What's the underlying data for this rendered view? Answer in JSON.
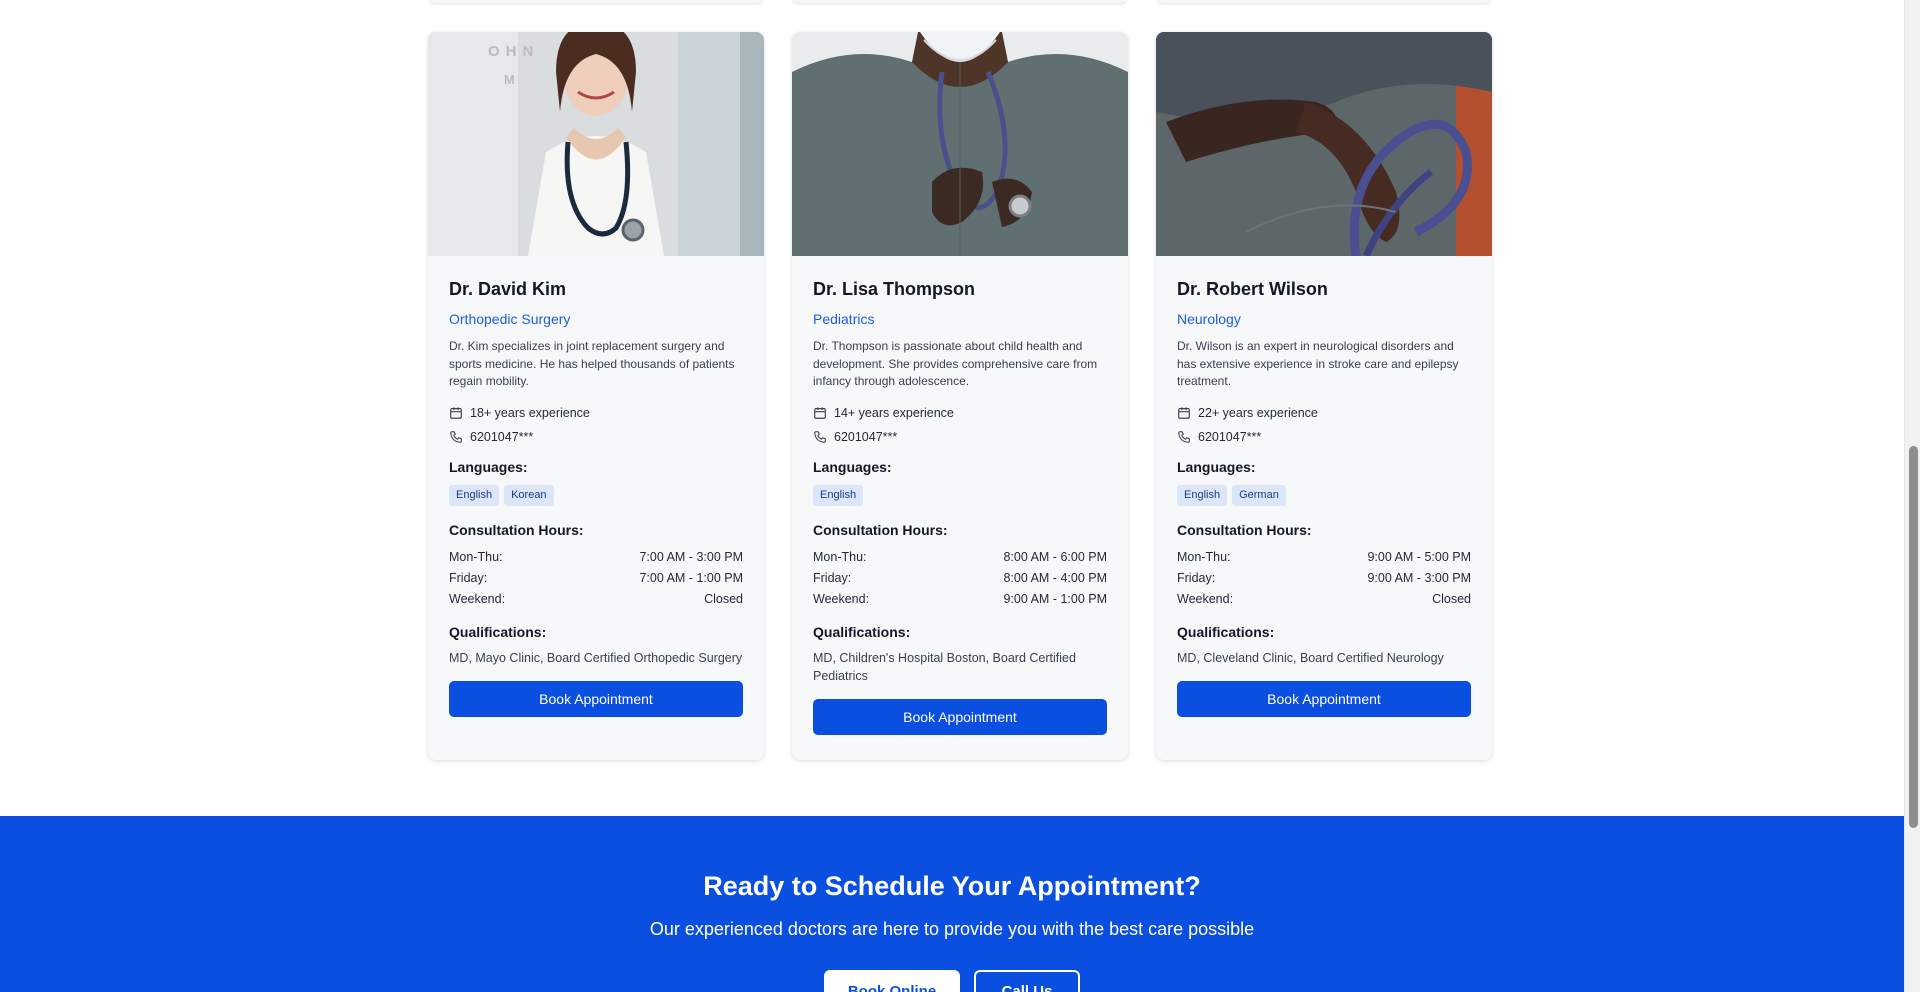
{
  "doctors": [
    {
      "name": "Dr. David Kim",
      "specialty": "Orthopedic Surgery",
      "bio": "Dr. Kim specializes in joint replacement surgery and sports medicine. He has helped thousands of patients regain mobility.",
      "experience": "18+ years experience",
      "phone": "6201047***",
      "languages_label": "Languages:",
      "languages": [
        "English",
        "Korean"
      ],
      "hours_label": "Consultation Hours:",
      "hours": [
        {
          "day": "Mon-Thu:",
          "time": "7:00 AM - 3:00 PM"
        },
        {
          "day": "Friday:",
          "time": "7:00 AM - 1:00 PM"
        },
        {
          "day": "Weekend:",
          "time": "Closed"
        }
      ],
      "qualifications_label": "Qualifications:",
      "qualifications": "MD, Mayo Clinic, Board Certified Orthopedic Surgery",
      "button": "Book Appointment"
    },
    {
      "name": "Dr. Lisa Thompson",
      "specialty": "Pediatrics",
      "bio": "Dr. Thompson is passionate about child health and development. She provides comprehensive care from infancy through adolescence.",
      "experience": "14+ years experience",
      "phone": "6201047***",
      "languages_label": "Languages:",
      "languages": [
        "English"
      ],
      "hours_label": "Consultation Hours:",
      "hours": [
        {
          "day": "Mon-Thu:",
          "time": "8:00 AM - 6:00 PM"
        },
        {
          "day": "Friday:",
          "time": "8:00 AM - 4:00 PM"
        },
        {
          "day": "Weekend:",
          "time": "9:00 AM - 1:00 PM"
        }
      ],
      "qualifications_label": "Qualifications:",
      "qualifications": "MD, Children's Hospital Boston, Board Certified Pediatrics",
      "button": "Book Appointment"
    },
    {
      "name": "Dr. Robert Wilson",
      "specialty": "Neurology",
      "bio": "Dr. Wilson is an expert in neurological disorders and has extensive experience in stroke care and epilepsy treatment.",
      "experience": "22+ years experience",
      "phone": "6201047***",
      "languages_label": "Languages:",
      "languages": [
        "English",
        "German"
      ],
      "hours_label": "Consultation Hours:",
      "hours": [
        {
          "day": "Mon-Thu:",
          "time": "9:00 AM - 5:00 PM"
        },
        {
          "day": "Friday:",
          "time": "9:00 AM - 3:00 PM"
        },
        {
          "day": "Weekend:",
          "time": "Closed"
        }
      ],
      "qualifications_label": "Qualifications:",
      "qualifications": "MD, Cleveland Clinic, Board Certified Neurology",
      "button": "Book Appointment"
    }
  ],
  "cta": {
    "title": "Ready to Schedule Your Appointment?",
    "subtitle": "Our experienced doctors are here to provide you with the best care possible",
    "primary_button": "Book Online",
    "secondary_button": "Call Us"
  },
  "colors": {
    "accent": "#0b4fe0",
    "specialty_link": "#1d5ce0",
    "card_background": "#f7f8fa",
    "language_tag": "#dbe6f8"
  },
  "icons": {
    "experience": "calendar-icon",
    "phone": "phone-icon"
  }
}
